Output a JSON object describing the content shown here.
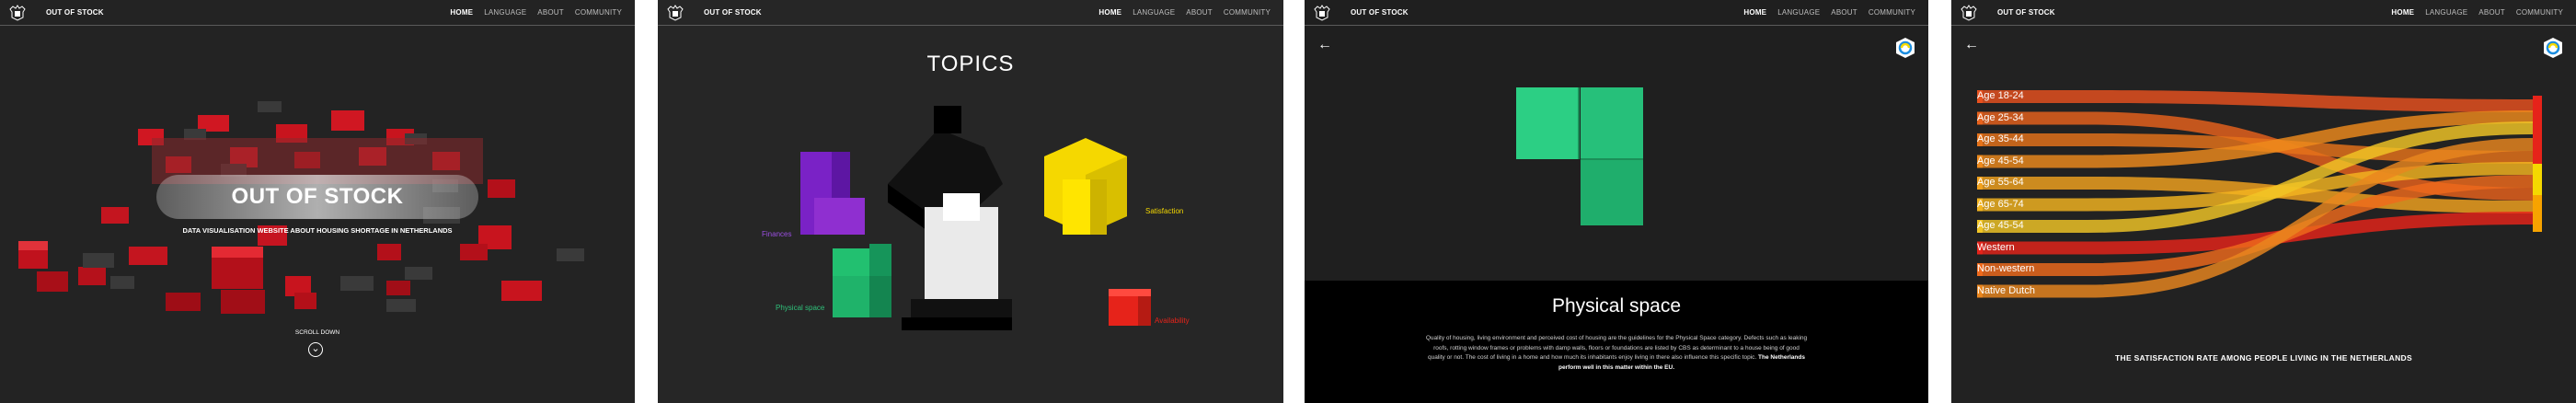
{
  "nav": {
    "brand": "OUT OF STOCK",
    "items": [
      "HOME",
      "LANGUAGE",
      "ABOUT",
      "COMMUNITY"
    ]
  },
  "screen1": {
    "title": "OUT OF STOCK",
    "subtitle": "DATA VISUALISATION WEBSITE ABOUT HOUSING SHORTAGE IN NETHERLANDS",
    "scroll_label": "SCROLL DOWN",
    "scroll_icon": "chevron-down-circle-icon"
  },
  "screen2": {
    "title": "TOPICS",
    "topics": [
      "Finances",
      "Physical space",
      "Satisfaction",
      "Availability"
    ],
    "colors": {
      "finances": "#8f2fd0",
      "physical": "#1fb36a",
      "satisfaction": "#f5d800",
      "availability": "#e6231a"
    }
  },
  "screen3": {
    "title": "Physical space",
    "body": "Quality of housing, living environment and perceived cost of housing are the guidelines for the Physical Space category. Defects such as leaking roofs, rotting window frames or problems with damp walls, floors or foundations are listed by CBS as determinant to a house being of good quality or not. The cost of living in a home and how much its inhabitants enjoy living in there also influence this specific topic.",
    "body_bold": "The Netherlands perform well in this matter within the EU."
  },
  "screen4": {
    "caption": "THE SATISFACTION RATE AMONG PEOPLE LIVING IN THE NETHERLANDS",
    "labels": [
      "Age 18-24",
      "Age 25-34",
      "Age 35-44",
      "Age 45-54",
      "Age 55-64",
      "Age 65-74",
      "Age 45-54",
      "Western",
      "Non-western",
      "Native Dutch"
    ]
  }
}
